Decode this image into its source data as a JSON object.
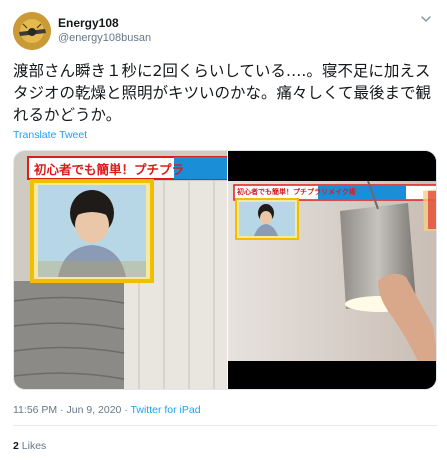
{
  "user": {
    "display_name": "Energy108",
    "handle": "@energy108busan"
  },
  "tweet": {
    "text": "渡部さん瞬き１秒に2回くらいしている….。寝不足に加えスタジオの乾燥と照明がキツいのかな。痛々しくて最後まで観れるかどうか。",
    "translate_label": "Translate Tweet"
  },
  "media": {
    "left_banner": "初心者でも簡単！プチプラ",
    "right_banner": "初心者でも簡単！プチプラリメイク術"
  },
  "meta": {
    "timestamp": "11:56 PM · Jun 9, 2020",
    "separator": "·",
    "source": "Twitter for iPad"
  },
  "stats": {
    "likes_count": "2",
    "likes_label": "Likes"
  },
  "icons": {
    "menu": "chevron-down-icon"
  }
}
